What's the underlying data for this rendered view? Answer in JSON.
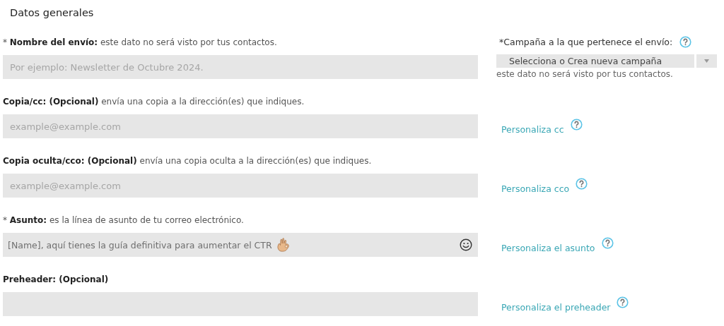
{
  "section_title": "Datos generales",
  "rows": [
    {
      "label": "* **Nombre del envío:** este dato no será visto por tus contactos.",
      "field": {
        "kind": "text",
        "placeholder": "Por ejemplo: Newsletter de Octubre 2024."
      },
      "side": {
        "kind": "select",
        "label": "*Campaña a la que pertenece el envío:",
        "value": "Selecciona o Crea nueva campaña",
        "note": "este dato no será visto por tus contactos.",
        "help": true
      }
    },
    {
      "label": "**Copia/cc: (Opcional)** envía una copia a la dirección(es) que indiques.",
      "field": {
        "kind": "text",
        "placeholder": "example@example.com"
      },
      "side": {
        "kind": "link",
        "label": "Personaliza cc",
        "help": true
      }
    },
    {
      "label": "**Copia oculta/cco: (Opcional)** envía una copia oculta a la dirección(es) que indiques.",
      "field": {
        "kind": "text",
        "placeholder": "example@example.com"
      },
      "side": {
        "kind": "link",
        "label": "Personaliza cco",
        "help": true
      }
    },
    {
      "label": "* **Asunto:** es la línea de asunto de tu correo electrónico.",
      "field": {
        "kind": "emoji",
        "value": "[Name], aquí tienes la guía definitiva para aumentar el CTR"
      },
      "side": {
        "kind": "link",
        "label": "Personaliza el asunto",
        "help": true
      }
    },
    {
      "label": "**Preheader: (Opcional)**",
      "field": {
        "kind": "text"
      },
      "side": {
        "kind": "link",
        "label": "Personaliza el preheader",
        "help": true
      }
    }
  ]
}
